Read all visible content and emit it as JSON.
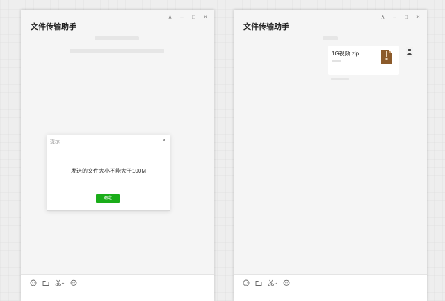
{
  "left_window": {
    "title": "文件传输助手",
    "dialog": {
      "title": "提示",
      "close_glyph": "×",
      "message": "发送的文件大小不能大于100M",
      "ok_label": "确定"
    }
  },
  "right_window": {
    "title": "文件传输助手",
    "file": {
      "name": "1G视频.zip",
      "icon": "zip-file-icon"
    }
  },
  "window_controls": {
    "pin": "⊼",
    "minimize": "–",
    "maximize": "□",
    "close": "×"
  },
  "toolbar_icons": [
    "emoji-icon",
    "folder-icon",
    "scissors-icon",
    "chat-history-icon"
  ],
  "colors": {
    "ok_button": "#1aad19",
    "window_bg": "#f5f5f5",
    "zip_icon": "#8b5a2b"
  }
}
